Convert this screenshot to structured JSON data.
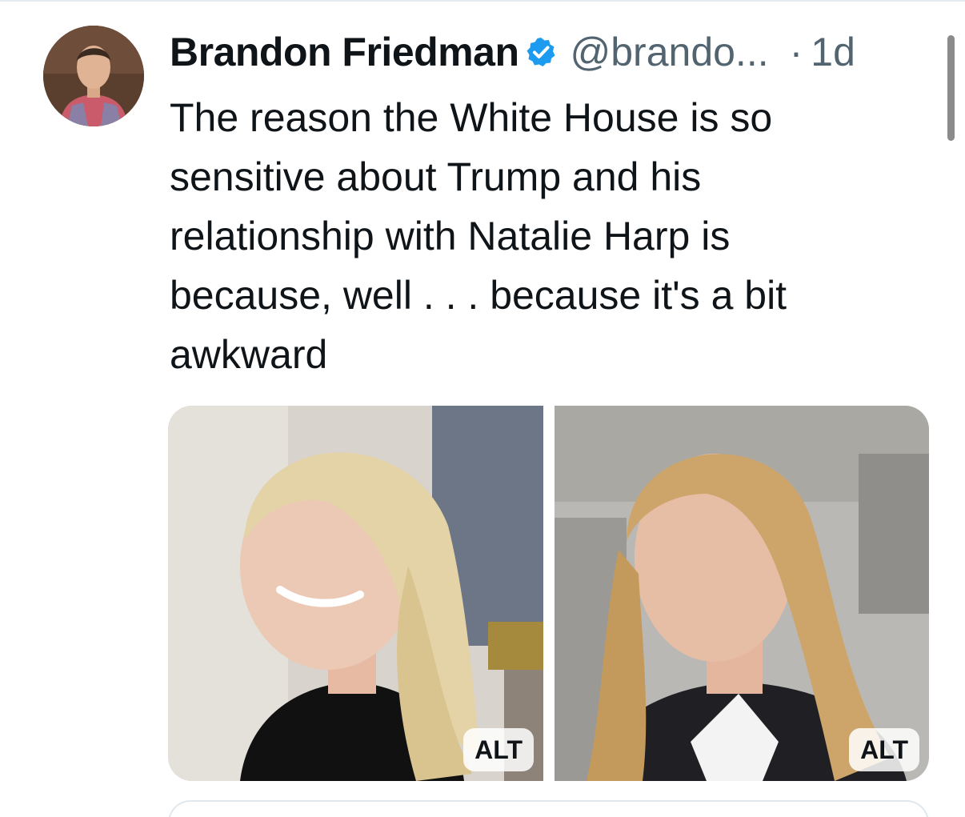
{
  "tweet": {
    "author": {
      "display_name": "Brandon Friedman",
      "handle": "@brando...",
      "verified": true,
      "avatar_icon": "profile-photo"
    },
    "separator": "·",
    "timestamp": "1d",
    "text_lines": [
      "The reason the White House is so",
      "sensitive about Trump and his",
      "relationship with Natalie Harp is",
      "because, well . . . because it's a bit",
      "awkward"
    ],
    "media": [
      {
        "alt_label": "ALT",
        "description_icon": "photo-woman-smiling"
      },
      {
        "alt_label": "ALT",
        "description_icon": "photo-woman-profile"
      }
    ]
  },
  "colors": {
    "text": "#0f1419",
    "secondary": "#536471",
    "verified_blue": "#1d9bf0",
    "divider": "#e6ecf0"
  }
}
